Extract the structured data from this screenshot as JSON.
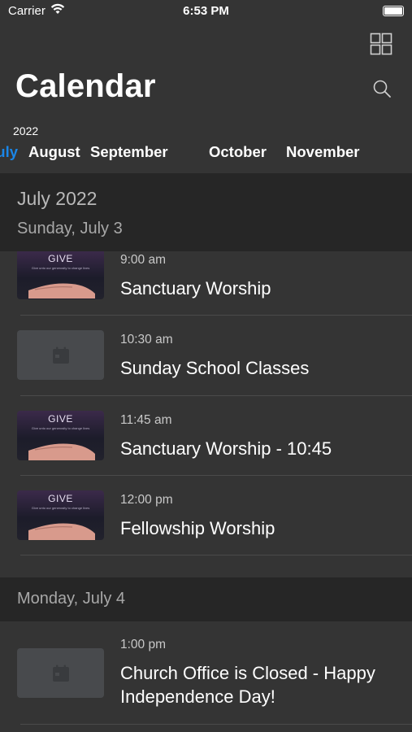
{
  "status_bar": {
    "carrier": "Carrier",
    "time": "6:53 PM"
  },
  "header": {
    "title": "Calendar",
    "year": "2022"
  },
  "months": [
    {
      "label": "July",
      "active": true
    },
    {
      "label": "August",
      "active": false
    },
    {
      "label": "September",
      "active": false
    },
    {
      "label": "October",
      "active": false
    },
    {
      "label": "November",
      "active": false
    }
  ],
  "section": {
    "month_heading": "July 2022"
  },
  "days": [
    {
      "heading": "Sunday, July 3",
      "events": [
        {
          "time": "9:00 am",
          "title": "Sanctuary Worship",
          "thumb": "give"
        },
        {
          "time": "10:30 am",
          "title": "Sunday School Classes",
          "thumb": "calendar-icon"
        },
        {
          "time": "11:45 am",
          "title": "Sanctuary Worship - 10:45",
          "thumb": "give"
        },
        {
          "time": "12:00 pm",
          "title": "Fellowship Worship",
          "thumb": "give"
        }
      ]
    },
    {
      "heading": "Monday, July 4",
      "events": [
        {
          "time": "1:00 pm",
          "title": "Church Office is Closed - Happy Independence Day!",
          "thumb": "calendar-icon"
        }
      ]
    }
  ],
  "give_image": {
    "label": "GIVE",
    "sub": "Give unto our generosity to change lives"
  },
  "colors": {
    "accent": "#1a86e8",
    "background": "#343434",
    "section_bg": "#262626"
  },
  "icons": [
    "wifi-icon",
    "battery-icon",
    "grid-view-icon",
    "search-icon",
    "calendar-icon",
    "hand-icon"
  ]
}
